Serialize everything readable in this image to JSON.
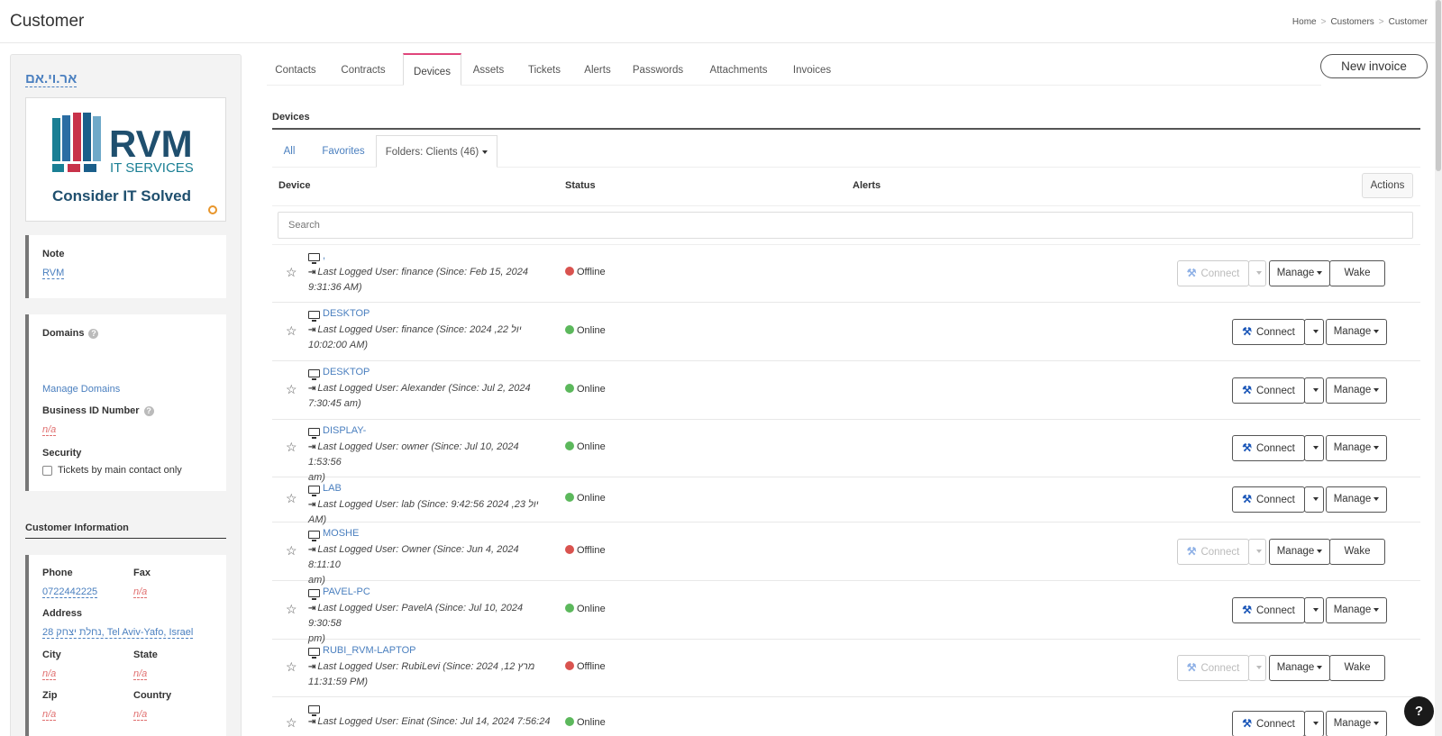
{
  "header": {
    "title": "Customer",
    "breadcrumb": [
      "Home",
      "Customers",
      "Customer"
    ]
  },
  "sidebar": {
    "customer_name": "אר.וי.אם",
    "logo": {
      "brand": "RVM",
      "sub": "IT SERVICES",
      "tagline": "Consider IT Solved"
    },
    "note": {
      "label": "Note",
      "value": "RVM"
    },
    "domains": {
      "label": "Domains",
      "manage_link": "Manage Domains",
      "business_id_label": "Business ID Number",
      "business_id_value": "n/a",
      "security_label": "Security",
      "security_checkbox": "Tickets by main contact only"
    },
    "customer_info": {
      "title": "Customer Information",
      "phone_label": "Phone",
      "phone_value": "0722442225",
      "fax_label": "Fax",
      "fax_value": "n/a",
      "address_label": "Address",
      "address_value": "28 נחלת יצחק, Tel Aviv-Yafo, Israel",
      "city_label": "City",
      "city_value": "n/a",
      "state_label": "State",
      "state_value": "n/a",
      "zip_label": "Zip",
      "zip_value": "n/a",
      "country_label": "Country",
      "country_value": "n/a"
    }
  },
  "tabs": [
    "Contacts",
    "Contracts",
    "Devices",
    "Assets",
    "Tickets",
    "Alerts",
    "Passwords",
    "Attachments",
    "Invoices"
  ],
  "new_invoice_label": "New invoice",
  "devices": {
    "title": "Devices",
    "subtabs": [
      "All",
      "Favorites",
      "Folders: Clients (46)"
    ],
    "columns": {
      "device": "Device",
      "status": "Status",
      "alerts": "Alerts"
    },
    "actions_label": "Actions",
    "search_placeholder": "Search",
    "connect_label": "Connect",
    "manage_label": "Manage",
    "wake_label": "Wake",
    "rows": [
      {
        "name": ",",
        "user1": "Last Logged User: finance (Since: Feb 15, 2024",
        "user2": "9:31:36 AM)",
        "status": "Offline"
      },
      {
        "name": "DESKTOP",
        "user1": "Last Logged User: finance (Since: 2024 ,22 יול",
        "user2": "10:02:00 AM)",
        "status": "Online"
      },
      {
        "name": "DESKTOP",
        "user1": "Last Logged User: Alexander (Since: Jul 2, 2024",
        "user2": "7:30:45 am)",
        "status": "Online"
      },
      {
        "name": "DISPLAY-",
        "user1": "Last Logged User: owner (Since: Jul 10, 2024 1:53:56",
        "user2": "am)",
        "status": "Online"
      },
      {
        "name": "LAB",
        "user1": "Last Logged User: lab (Since: 9:42:56 2024 ,23 יול AM)",
        "user2": "",
        "status": "Online"
      },
      {
        "name": "MOSHE",
        "user1": "Last Logged User: Owner (Since: Jun 4, 2024 8:11:10",
        "user2": "am)",
        "status": "Offline"
      },
      {
        "name": "PAVEL-PC",
        "user1": "Last Logged User: PavelA (Since: Jul 10, 2024 9:30:58",
        "user2": "pm)",
        "status": "Online"
      },
      {
        "name": "RUBI_RVM-LAPTOP",
        "user1": "Last Logged User: RubiLevi (Since: 2024 ,12 מרץ",
        "user2": "11:31:59 PM)",
        "status": "Offline"
      },
      {
        "name": "",
        "user1": "Last Logged User: Einat (Since: Jul 14, 2024 7:56:24",
        "user2": "",
        "status": "Online"
      }
    ]
  },
  "help_label": "?"
}
